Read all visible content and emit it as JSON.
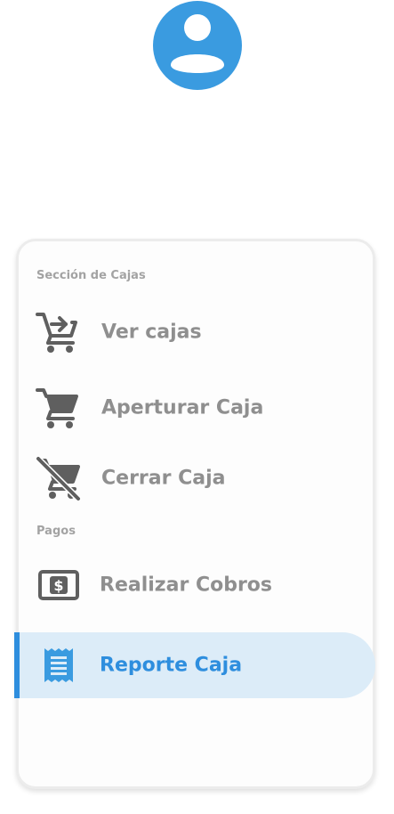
{
  "colors": {
    "accent": "#3a9be0",
    "active_background": "#dcecf8",
    "active_text": "#2e8ede",
    "icon_gray": "#5f5f5f",
    "label_gray": "#8f8f8f",
    "section_gray": "#a3a3a3"
  },
  "profile": {
    "avatar_icon": "account-circle-icon"
  },
  "menu": {
    "sections": [
      {
        "title": "Sección de Cajas",
        "items": [
          {
            "label": "Ver cajas",
            "icon": "cart-arrow-right-icon",
            "active": false
          },
          {
            "label": "Aperturar Caja",
            "icon": "cart-icon",
            "active": false
          },
          {
            "label": "Cerrar Caja",
            "icon": "cart-off-icon",
            "active": false
          }
        ]
      },
      {
        "title": "Pagos",
        "items": [
          {
            "label": "Realizar Cobros",
            "icon": "cash-icon",
            "active": false
          },
          {
            "label": "Reporte Caja",
            "icon": "receipt-icon",
            "active": true
          }
        ]
      }
    ]
  }
}
